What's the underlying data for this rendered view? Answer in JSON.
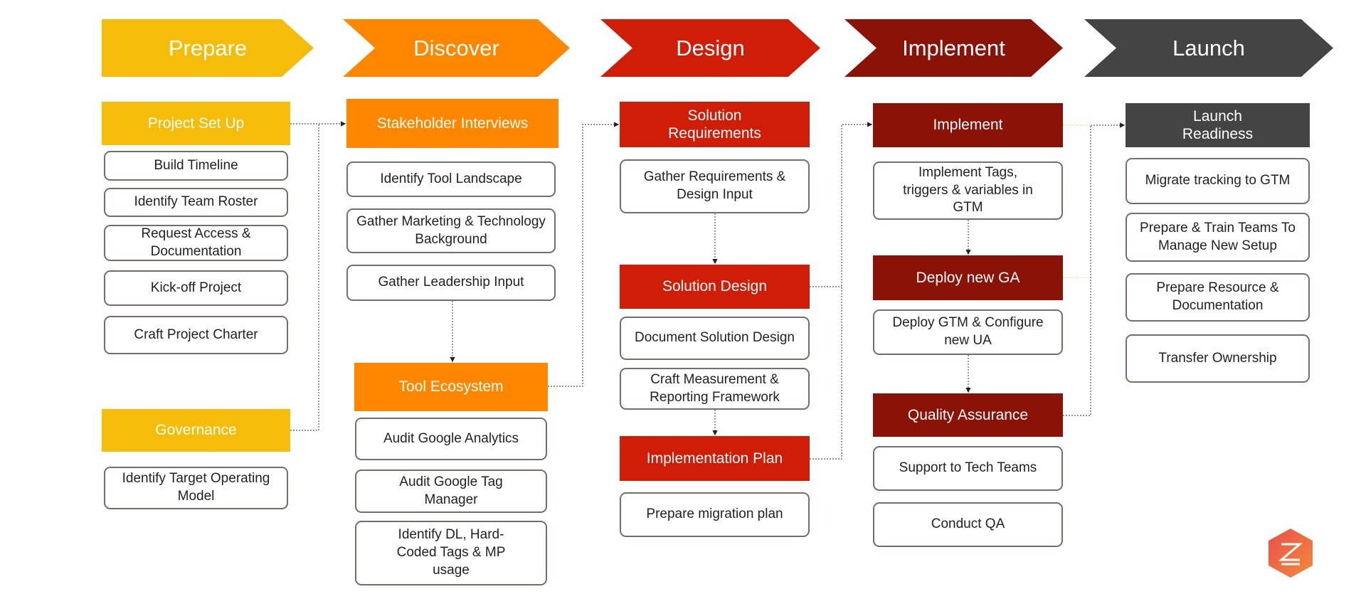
{
  "colors": {
    "prepare": "#F5BD0A",
    "discover": "#FF8700",
    "design": "#D01D07",
    "implement": "#8A1206",
    "launch": "#444444"
  },
  "phases": [
    {
      "label": "Prepare"
    },
    {
      "label": "Discover"
    },
    {
      "label": "Design"
    },
    {
      "label": "Implement"
    },
    {
      "label": "Launch"
    }
  ],
  "groups": {
    "project_set_up": {
      "label": "Project Set Up",
      "items": [
        "Build Timeline",
        "Identify Team Roster",
        "Request Access & Documentation",
        "Kick-off Project",
        "Craft Project Charter"
      ]
    },
    "governance": {
      "label": "Governance",
      "items": [
        "Identify Target Operating Model"
      ]
    },
    "stakeholder_interviews": {
      "label": "Stakeholder Interviews",
      "items": [
        "Identify Tool Landscape",
        "Gather Marketing & Technology Background",
        "Gather Leadership Input"
      ]
    },
    "tool_ecosystem": {
      "label": "Tool Ecosystem",
      "items": [
        "Audit Google Analytics",
        "Audit Google Tag Manager",
        "Identify DL, Hard-Coded Tags & MP usage"
      ]
    },
    "solution_requirements": {
      "label": "Solution Requirements",
      "items": [
        "Gather Requirements & Design Input"
      ]
    },
    "solution_design": {
      "label": "Solution Design",
      "items": [
        "Document Solution Design",
        "Craft Measurement & Reporting Framework"
      ]
    },
    "implementation_plan": {
      "label": "Implementation Plan",
      "items": [
        "Prepare migration plan"
      ]
    },
    "implement": {
      "label": "Implement",
      "items": [
        "Implement Tags, triggers & variables in GTM"
      ]
    },
    "deploy_new_ga": {
      "label": "Deploy new GA",
      "items": [
        "Deploy GTM & Configure new UA"
      ]
    },
    "quality_assurance": {
      "label": "Quality Assurance",
      "items": [
        "Support to Tech Teams",
        "Conduct QA"
      ]
    },
    "launch_readiness": {
      "label": "Launch Readiness",
      "items": [
        "Migrate tracking to GTM",
        "Prepare & Train Teams To Manage New Setup",
        "Prepare Resource & Documentation",
        "Transfer Ownership"
      ]
    }
  },
  "logo": {
    "icon": "z-hexagon-logo"
  }
}
